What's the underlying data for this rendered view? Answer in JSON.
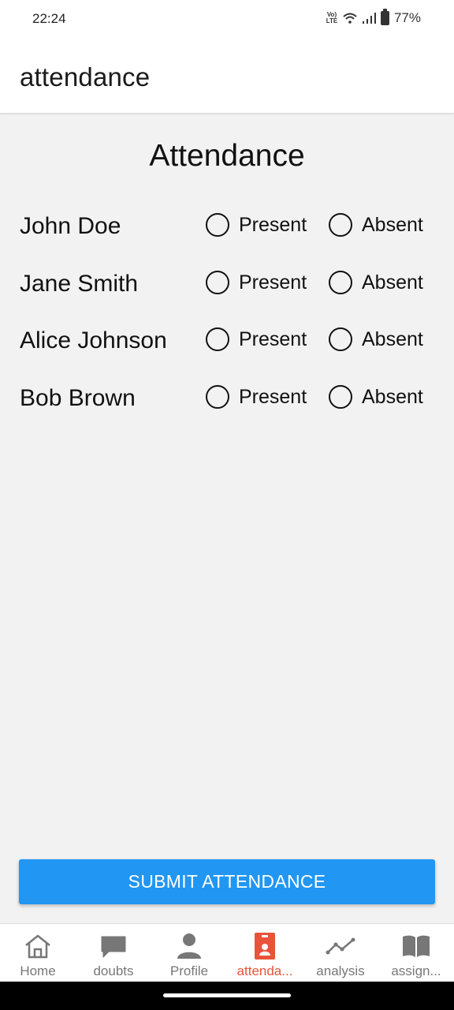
{
  "status_bar": {
    "time": "22:24",
    "network": "Vo) LTE",
    "battery": "77%"
  },
  "app_bar": {
    "title": "attendance"
  },
  "heading": "Attendance",
  "students": [
    {
      "name": "John Doe",
      "present_label": "Present",
      "absent_label": "Absent"
    },
    {
      "name": "Jane Smith",
      "present_label": "Present",
      "absent_label": "Absent"
    },
    {
      "name": "Alice Johnson",
      "present_label": "Present",
      "absent_label": "Absent"
    },
    {
      "name": "Bob Brown",
      "present_label": "Present",
      "absent_label": "Absent"
    }
  ],
  "submit_label": "SUBMIT ATTENDANCE",
  "bottom_nav": [
    {
      "label": "Home",
      "icon": "home-icon",
      "active": false
    },
    {
      "label": "doubts",
      "icon": "chat-icon",
      "active": false
    },
    {
      "label": "Profile",
      "icon": "person-icon",
      "active": false
    },
    {
      "label": "attenda...",
      "icon": "badge-icon",
      "active": true
    },
    {
      "label": "analysis",
      "icon": "trend-icon",
      "active": false
    },
    {
      "label": "assign...",
      "icon": "book-icon",
      "active": false
    }
  ],
  "colors": {
    "accent": "#2196f3",
    "active_tab": "#e8533a",
    "background": "#f2f2f2"
  }
}
